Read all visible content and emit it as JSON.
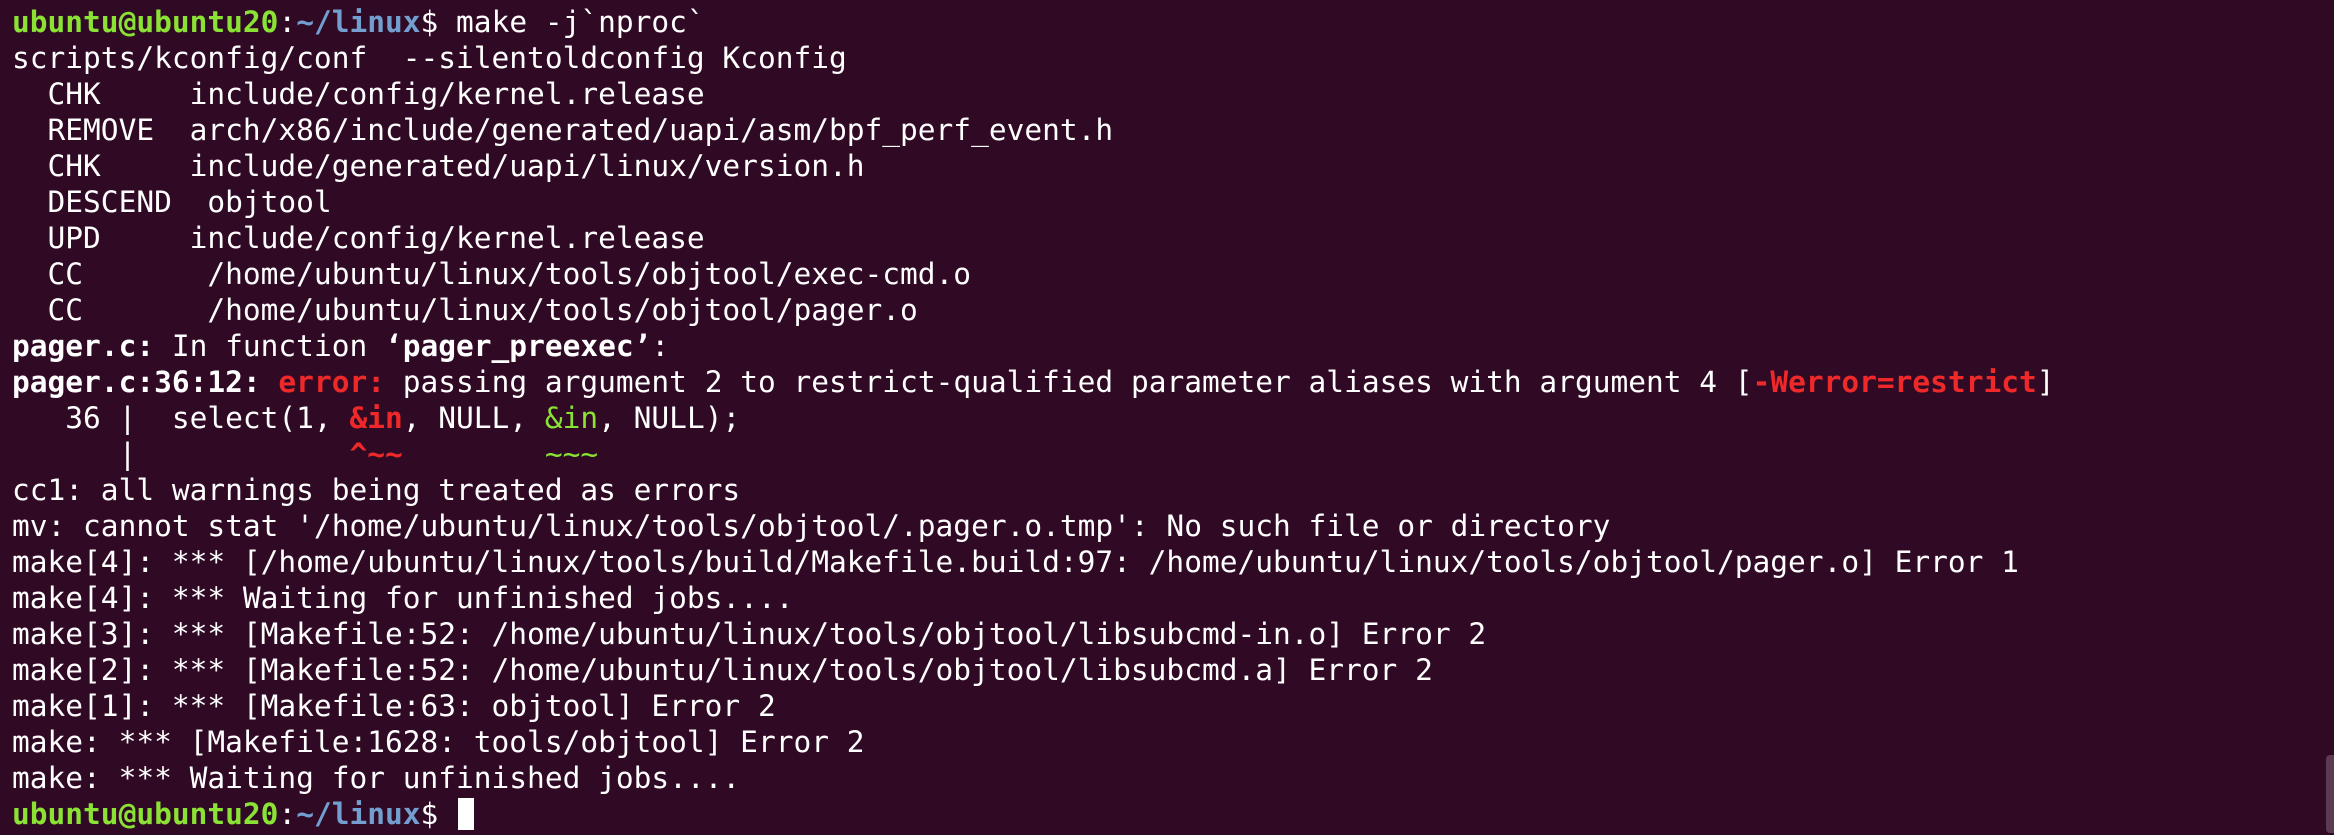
{
  "prompt": {
    "user_host": "ubuntu@ubuntu20",
    "colon": ":",
    "path": "~/linux",
    "dollar": "$"
  },
  "top_fragment": "\"",
  "lines": {
    "cmd": " make -j`nproc`",
    "l1": "scripts/kconfig/conf  --silentoldconfig Kconfig",
    "l2": "  CHK     include/config/kernel.release",
    "l3": "  REMOVE  arch/x86/include/generated/uapi/asm/bpf_perf_event.h",
    "l4": "  CHK     include/generated/uapi/linux/version.h",
    "l5": "  DESCEND  objtool",
    "l6": "  UPD     include/config/kernel.release",
    "l7": "  CC       /home/ubuntu/linux/tools/objtool/exec-cmd.o",
    "l8": "  CC       /home/ubuntu/linux/tools/objtool/pager.o",
    "l9_a": "pager.c:",
    "l9_b": " In function ",
    "l9_c": "‘pager_preexec’",
    "l9_d": ":",
    "l10_a": "pager.c:36:12:",
    "l10_b": " ",
    "l10_c": "error:",
    "l10_d": " passing argument 2 to restrict-qualified parameter aliases with argument 4 [",
    "l10_e": "-Werror=restrict",
    "l10_f": "]",
    "l11_a": "   36 |  select(1, ",
    "l11_b": "&in",
    "l11_c": ", NULL, ",
    "l11_d": "&in",
    "l11_e": ", NULL);",
    "l12_a": "      |            ",
    "l12_b": "^~~",
    "l12_c": "        ",
    "l12_d": "~~~",
    "l13": "cc1: all warnings being treated as errors",
    "l14": "mv: cannot stat '/home/ubuntu/linux/tools/objtool/.pager.o.tmp': No such file or directory",
    "l15": "make[4]: *** [/home/ubuntu/linux/tools/build/Makefile.build:97: /home/ubuntu/linux/tools/objtool/pager.o] Error 1",
    "l16": "make[4]: *** Waiting for unfinished jobs....",
    "l17": "make[3]: *** [Makefile:52: /home/ubuntu/linux/tools/objtool/libsubcmd-in.o] Error 2",
    "l18": "make[2]: *** [Makefile:52: /home/ubuntu/linux/tools/objtool/libsubcmd.a] Error 2",
    "l19": "make[1]: *** [Makefile:63: objtool] Error 2",
    "l20": "make: *** [Makefile:1628: tools/objtool] Error 2",
    "l21": "make: *** Waiting for unfinished jobs....",
    "last_cmd": " "
  },
  "colors": {
    "background": "#300a24",
    "foreground": "#ffffff",
    "prompt_user": "#8ae234",
    "prompt_path": "#729fcf",
    "error": "#ef2929",
    "note_green": "#8ae234"
  }
}
